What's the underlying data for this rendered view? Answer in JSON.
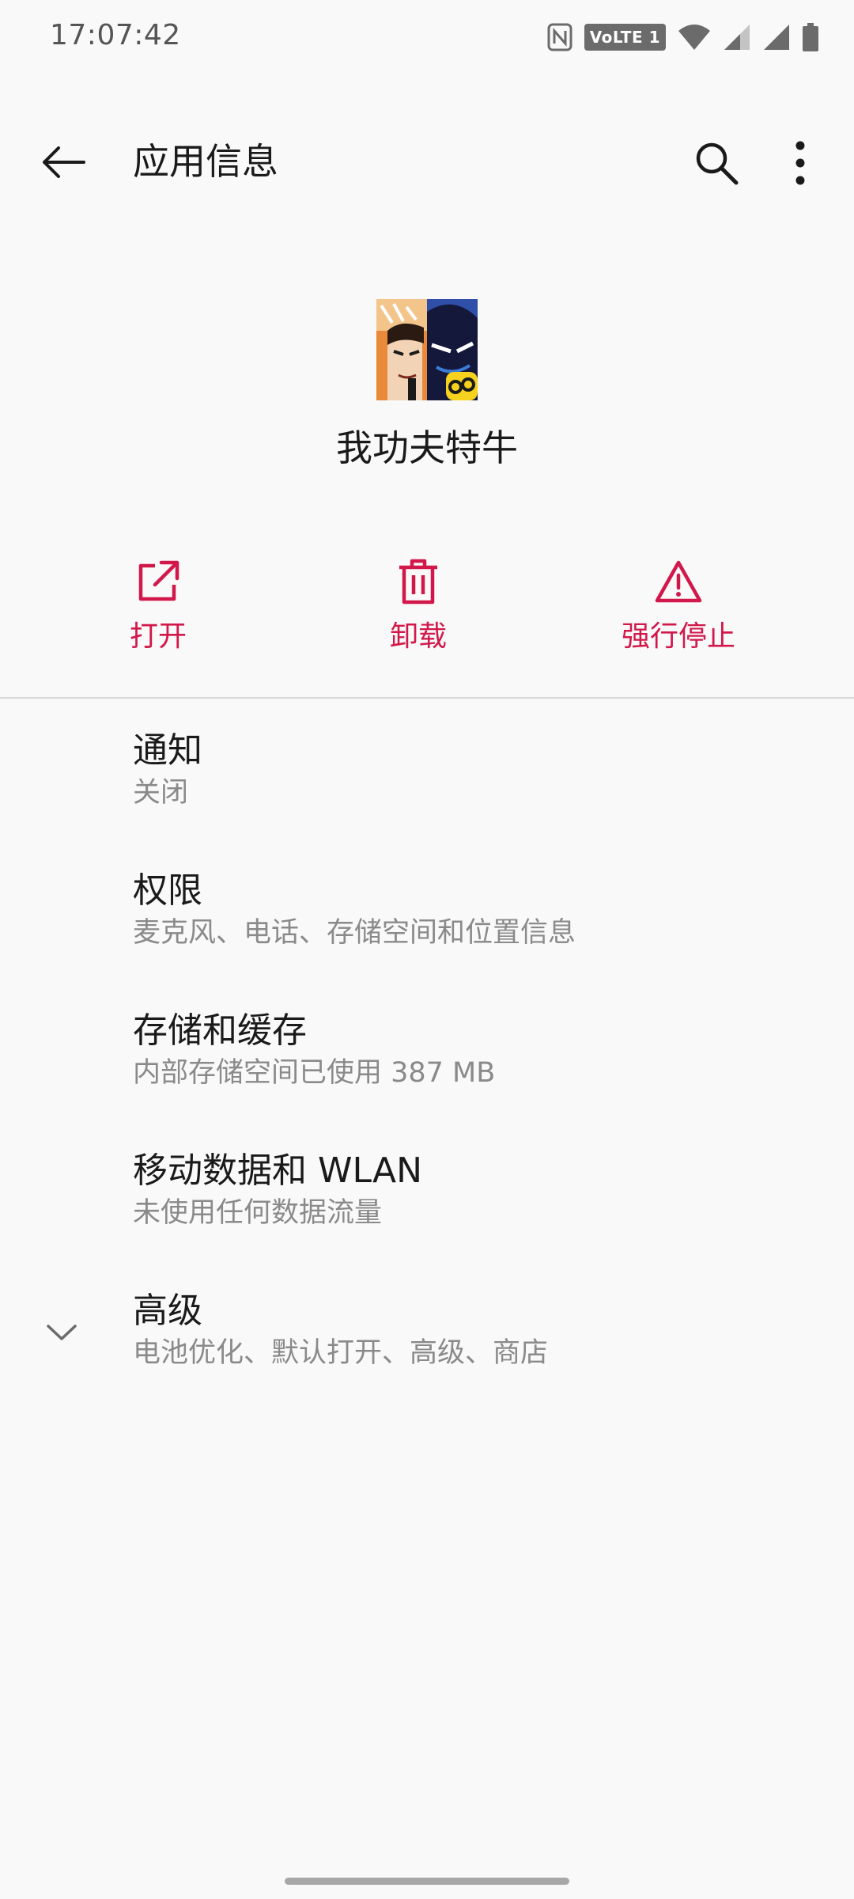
{
  "status_bar": {
    "time": "17:07:42",
    "volte_label": "VoLTE 1",
    "icons": [
      "nfc-icon",
      "volte-icon",
      "wifi-icon",
      "signal-icon-1",
      "signal-icon-2",
      "battery-icon"
    ]
  },
  "toolbar": {
    "title": "应用信息",
    "back_icon": "arrow-left-icon",
    "search_icon": "search-icon",
    "more_icon": "more-vert-icon"
  },
  "app": {
    "name": "我功夫特牛",
    "icon": "app-icon"
  },
  "actions": [
    {
      "label": "打开",
      "icon": "open-external-icon"
    },
    {
      "label": "卸载",
      "icon": "trash-icon"
    },
    {
      "label": "强行停止",
      "icon": "warning-icon"
    }
  ],
  "accent_color": "#d2184a",
  "settings": [
    {
      "title": "通知",
      "summary": "关闭"
    },
    {
      "title": "权限",
      "summary": "麦克风、电话、存储空间和位置信息"
    },
    {
      "title": "存储和缓存",
      "summary": "内部存储空间已使用 387 MB"
    },
    {
      "title": "移动数据和 WLAN",
      "summary": "未使用任何数据流量"
    },
    {
      "title": "高级",
      "summary": "电池优化、默认打开、高级、商店",
      "icon": "chevron-down-icon"
    }
  ]
}
